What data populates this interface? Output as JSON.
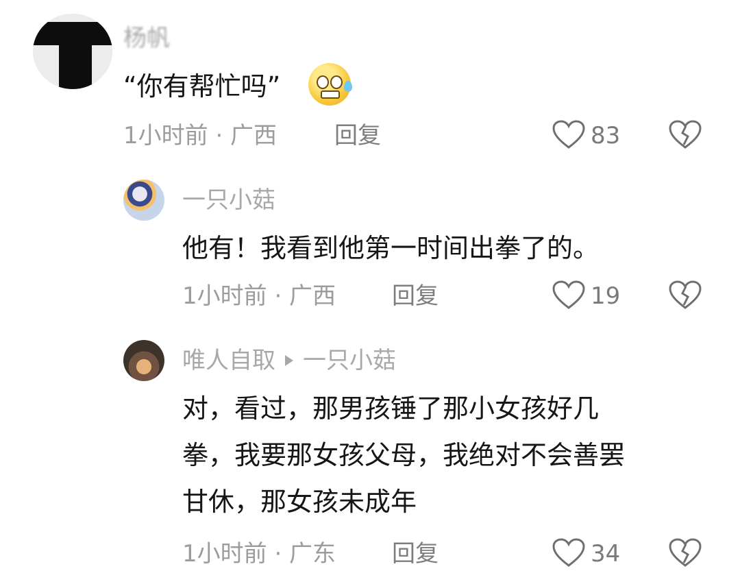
{
  "comments": [
    {
      "username": "杨帆",
      "text": "“你有帮忙吗”",
      "emoji": "anxious-sweat-emoji",
      "time": "1小时前 · 广西",
      "reply_label": "回复",
      "likes": "83"
    },
    {
      "username": "一只小菇",
      "text": "他有！我看到他第一时间出拳了的。",
      "time": "1小时前 · 广西",
      "reply_label": "回复",
      "likes": "19"
    },
    {
      "username": "唯人自取",
      "reply_to": "一只小菇",
      "text_lines": [
        "对，看过，那男孩锤了那小女孩好几",
        "拳，我要那女孩父母，我绝对不会善罢",
        "甘休，那女孩未成年"
      ],
      "time": "1小时前 · 广东",
      "reply_label": "回复",
      "likes": "34"
    }
  ],
  "icons": {
    "like": "heart-outline-icon",
    "dislike": "broken-heart-icon",
    "reply_arrow": "play-arrow-icon"
  },
  "colors": {
    "username": "#a8a8a8",
    "text": "#161616",
    "meta": "#9c9c9c",
    "icon": "#6f6f6f"
  }
}
